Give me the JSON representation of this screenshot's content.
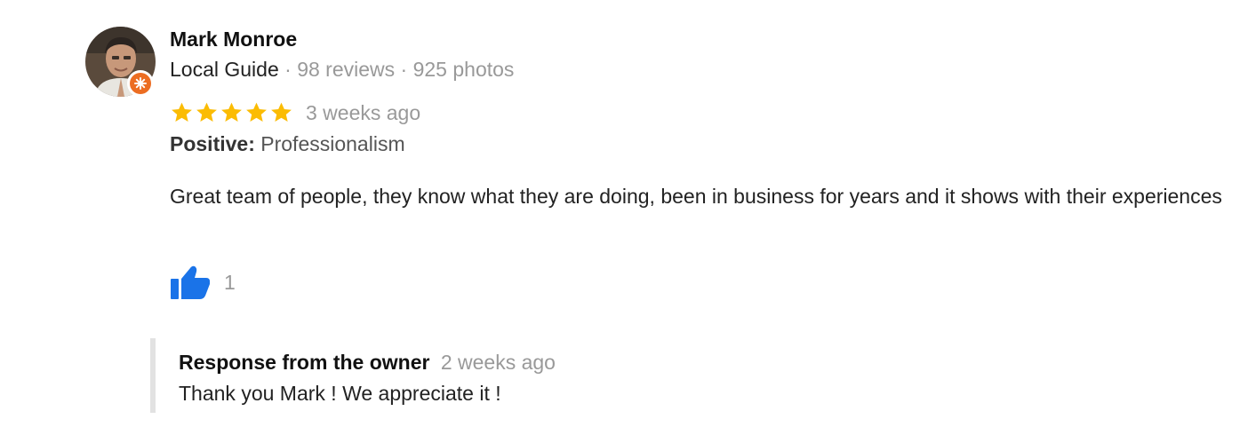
{
  "reviewer": {
    "name": "Mark Monroe",
    "guide_label": "Local Guide",
    "separator": " · ",
    "reviews": "98 reviews",
    "photos": "925 photos"
  },
  "rating": {
    "stars": 5,
    "max": 5,
    "star_color": "#fbbc04",
    "time": "3 weeks ago"
  },
  "attributes": {
    "label": "Positive:",
    "value": "Professionalism"
  },
  "review": {
    "text": "Great team of people, they know what they are doing, been in business for years and it shows with their experiences"
  },
  "likes": {
    "icon": "thumbs-up-icon",
    "count": "1",
    "color": "#1a73e8"
  },
  "owner_response": {
    "title": "Response from the owner",
    "time": "2 weeks ago",
    "text": "Thank you Mark ! We appreciate it !"
  },
  "badge": {
    "icon": "local-guide-badge-icon",
    "color": "#ec6d22"
  }
}
